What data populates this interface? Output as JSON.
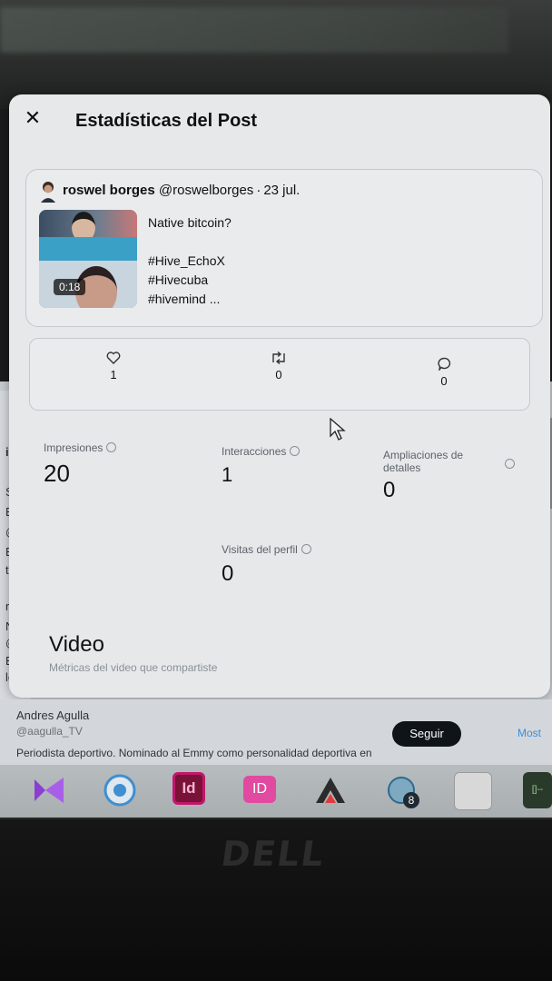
{
  "modal": {
    "title": "Estadísticas del Post",
    "close_icon": "close-icon"
  },
  "post": {
    "author": "roswel borges",
    "handle": "@roswelborges",
    "separator": "·",
    "date": "23 jul.",
    "duration": "0:18",
    "text_lines": [
      "Native bitcoin?",
      "",
      "#Hive_EchoX",
      "#Hivecuba",
      "#hivemind ..."
    ]
  },
  "engagement": {
    "likes": "1",
    "reposts": "0",
    "replies": "0"
  },
  "metrics": {
    "impressions_label": "Impresiones",
    "impressions_value": "20",
    "interactions_label": "Interacciones",
    "interactions_value": "1",
    "expansions_label_1": "Ampliaciones de",
    "expansions_label_2": "detalles",
    "expansions_value": "0",
    "profile_visits_label": "Visitas del perfil",
    "profile_visits_value": "0"
  },
  "video": {
    "title": "Video",
    "subtitle": "Métricas del video que compartiste"
  },
  "suggestion": {
    "name": "Andres Agulla",
    "handle": "@aagulla_TV",
    "bio": "Periodista deportivo. Nominado al Emmy como personalidad deportiva en",
    "follow_label": "Seguir",
    "more_label": "Most"
  },
  "background_left_letters": [
    "ie",
    "S",
    "E",
    "@",
    "E",
    "t",
    "r",
    "N",
    "@",
    "B",
    "le"
  ],
  "taskbar": {
    "icons": [
      {
        "name": "visual-studio-icon",
        "color": "#8a3fd1"
      },
      {
        "name": "browser-icon",
        "color": "#3f8fd1"
      },
      {
        "name": "indesign-icon",
        "label": "Id",
        "color": "#c1176c"
      },
      {
        "name": "indesign-alt-icon",
        "label": "ID",
        "color": "#e04aa0"
      },
      {
        "name": "app-a-icon",
        "color": "#e23a3a"
      },
      {
        "name": "chat-icon",
        "label": "8",
        "color": "#2c6a8e"
      },
      {
        "name": "files-icon",
        "color": "#d8d8d8"
      },
      {
        "name": "terminal-icon",
        "label": "[]--",
        "color": "#2a3a2a"
      }
    ]
  },
  "monitor_brand": "DELL"
}
